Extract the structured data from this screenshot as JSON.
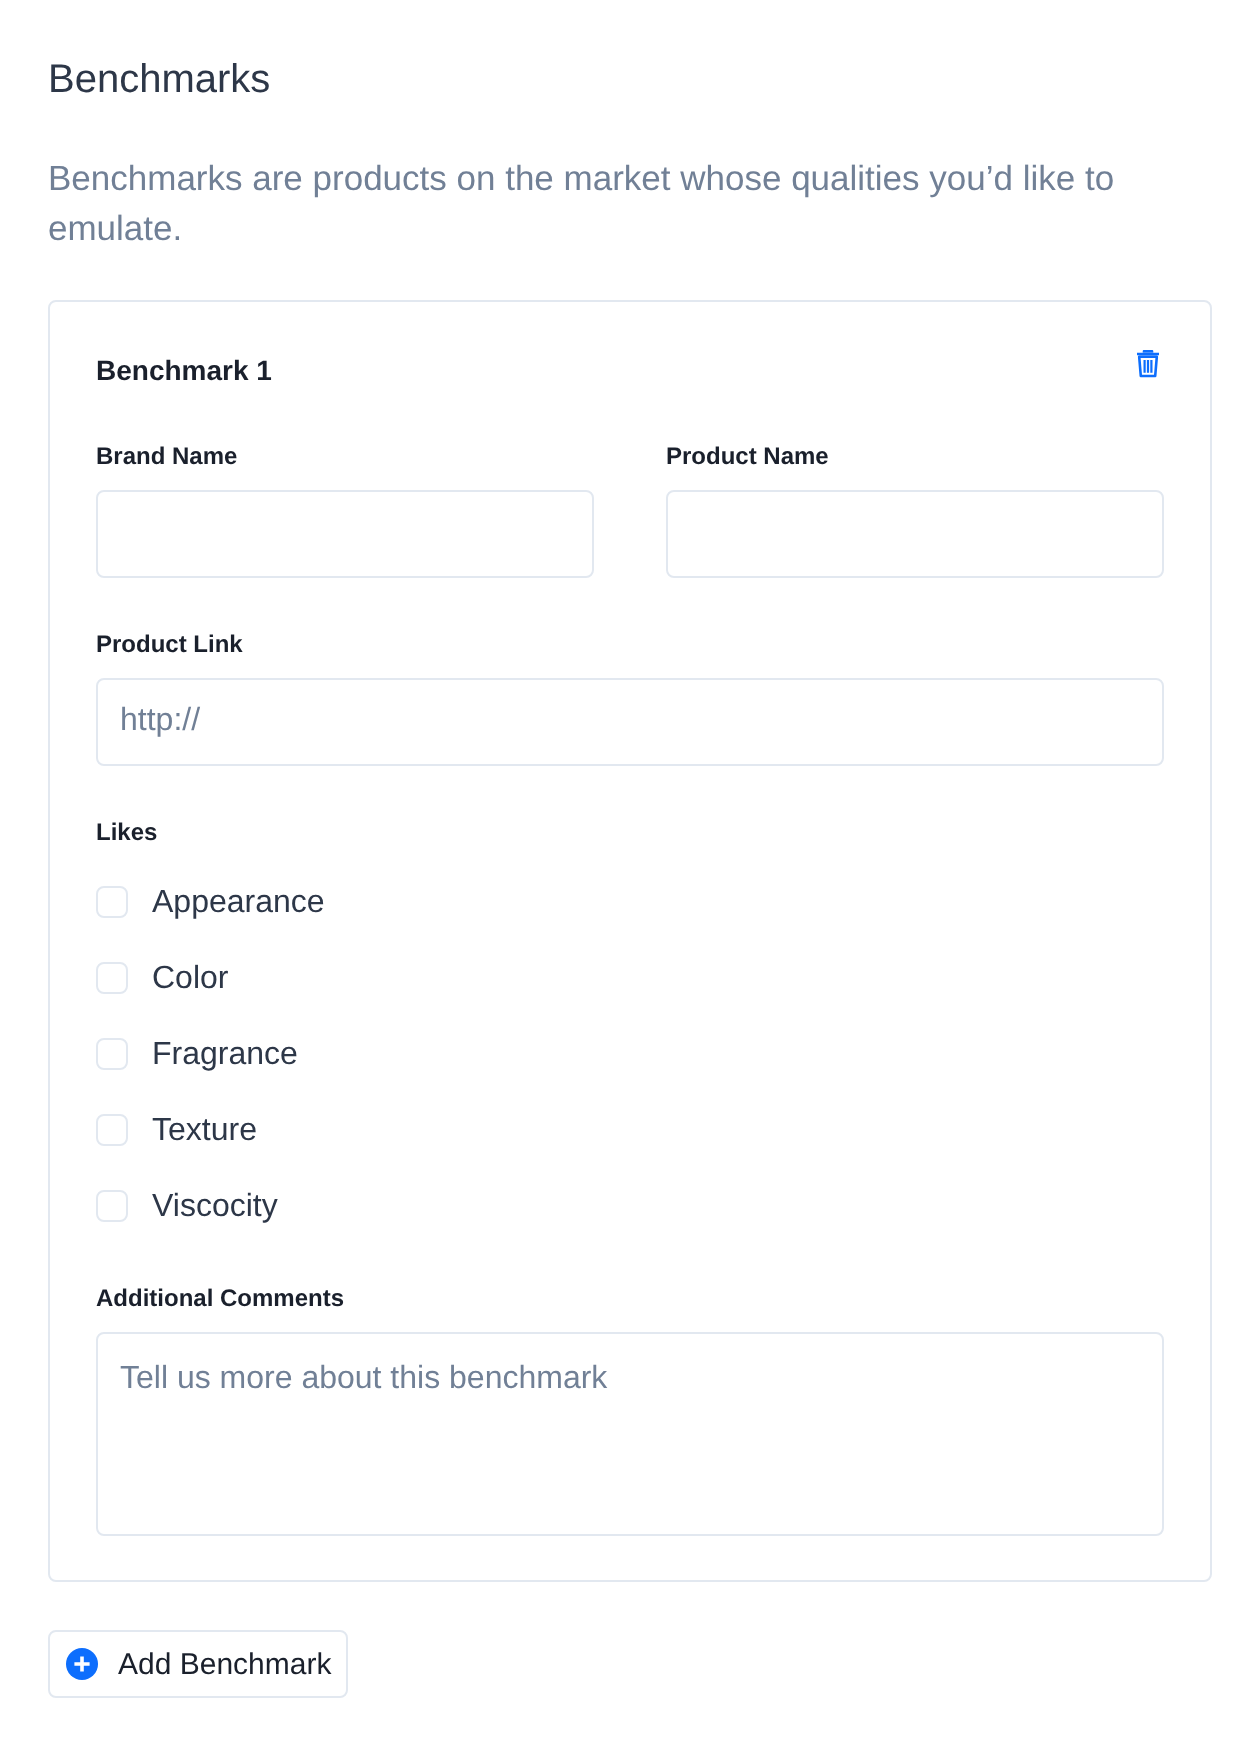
{
  "section": {
    "title": "Benchmarks",
    "description": "Benchmarks are products on the market whose qualities you’d like to emulate."
  },
  "benchmarks": [
    {
      "title": "Benchmark 1",
      "brand_name": {
        "label": "Brand Name"
      },
      "product_name": {
        "label": "Product Name"
      },
      "product_link": {
        "label": "Product Link",
        "placeholder": "http://"
      },
      "likes": {
        "label": "Likes",
        "options": [
          {
            "label": "Appearance",
            "checked": false
          },
          {
            "label": "Color",
            "checked": false
          },
          {
            "label": "Fragrance",
            "checked": false
          },
          {
            "label": "Texture",
            "checked": false
          },
          {
            "label": "Viscocity",
            "checked": false
          }
        ]
      },
      "additional_comments": {
        "label": "Additional Comments",
        "placeholder": "Tell us more about this benchmark"
      }
    }
  ],
  "add_button": {
    "label": "Add Benchmark"
  }
}
